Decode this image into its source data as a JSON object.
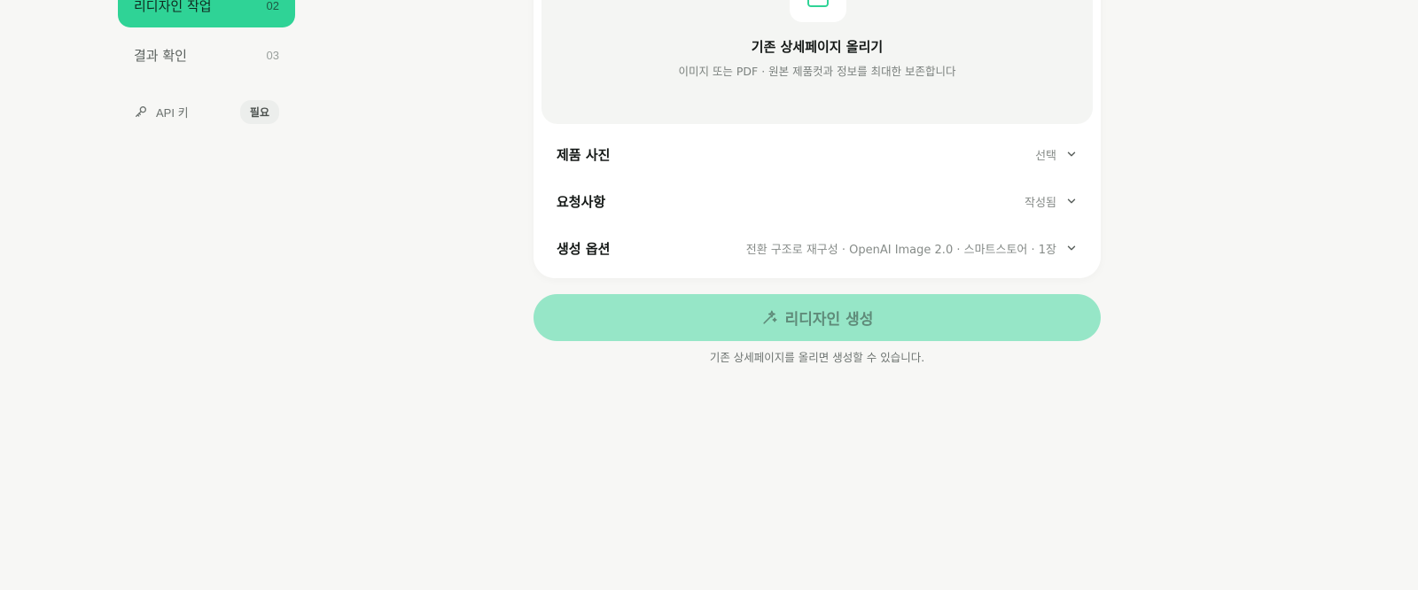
{
  "sidebar": {
    "items": [
      {
        "label": "리디자인 작업",
        "num": "02"
      },
      {
        "label": "결과 확인",
        "num": "03"
      }
    ],
    "api": {
      "label": "API 키",
      "badge": "필요"
    }
  },
  "upload": {
    "title": "기존 상세페이지 올리기",
    "subtitle": "이미지 또는 PDF · 원본 제품컷과 정보를 최대한 보존합니다"
  },
  "sections": [
    {
      "title": "제품 사진",
      "value": "선택"
    },
    {
      "title": "요청사항",
      "value": "작성됨"
    },
    {
      "title": "생성 옵션",
      "value": "전환 구조로 재구성 · OpenAI Image 2.0 · 스마트스토어 · 1장"
    }
  ],
  "generate": {
    "label": "리디자인 생성",
    "hint": "기존 상세페이지를 올리면 생성할 수 있습니다."
  },
  "colors": {
    "accent": "#2fd396",
    "accent_disabled": "#96e6c7",
    "background": "#f7f7f5"
  }
}
